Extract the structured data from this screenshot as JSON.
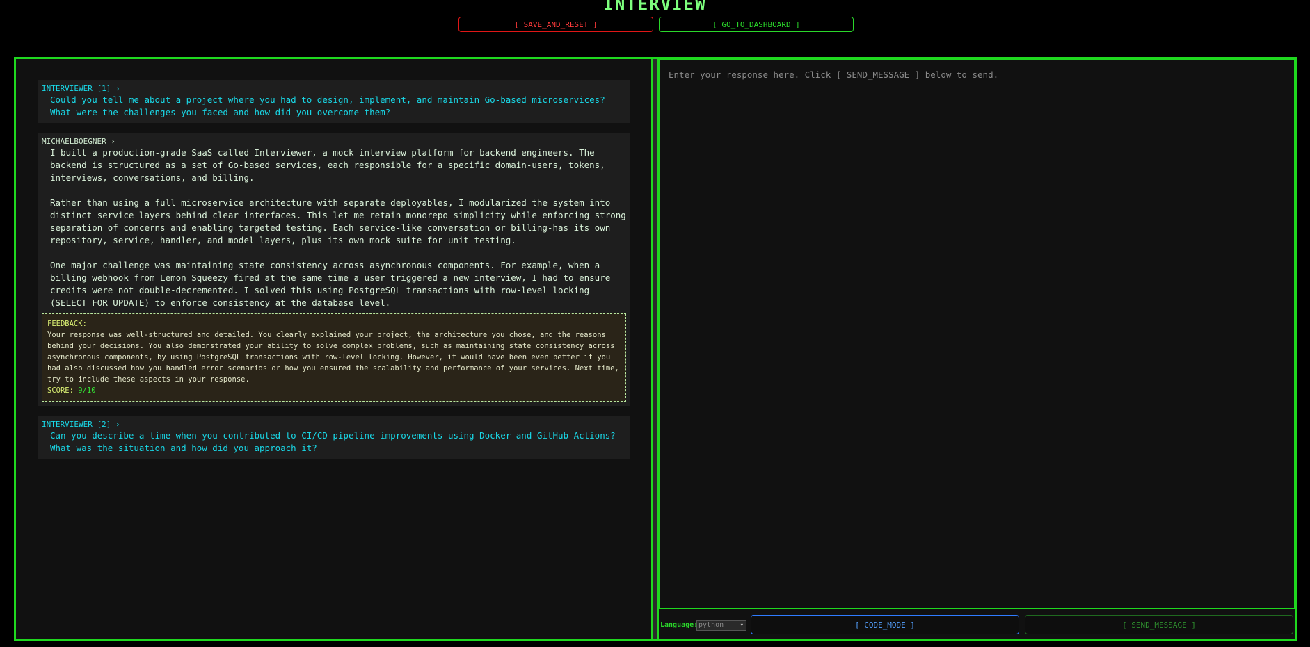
{
  "header": {
    "title": "INTERVIEW",
    "save_reset_label": "[ SAVE_AND_RESET ]",
    "dashboard_label": "[ GO_TO_DASHBOARD ]"
  },
  "chat": {
    "q1": {
      "label": "INTERVIEWER [1] ›",
      "text": "Could you tell me about a project where you had to design, implement, and maintain Go-based microservices? What were the challenges you faced and how did you overcome them?"
    },
    "a1": {
      "label": "MICHAELBOEGNER ›",
      "p1": "I built a production-grade SaaS called Interviewer, a mock interview platform for backend engineers. The backend is structured as a set of Go-based services, each responsible for a specific domain-users, tokens, interviews, conversations, and billing.",
      "p2": "Rather than using a full microservice architecture with separate deployables, I modularized the system into distinct service layers behind clear interfaces. This let me retain monorepo simplicity while enforcing strong separation of concerns and enabling targeted testing. Each service-like conversation or billing-has its own repository, service, handler, and model layers, plus its own mock suite for unit testing.",
      "p3": "One major challenge was maintaining state consistency across asynchronous components. For example, when a billing webhook from Lemon Squeezy fired at the same time a user triggered a new interview, I had to ensure credits were not double-decremented. I solved this using PostgreSQL transactions with row-level locking (SELECT FOR UPDATE) to enforce consistency at the database level.",
      "feedback": {
        "title": "FEEDBACK:",
        "text": "Your response was well-structured and detailed. You clearly explained your project, the architecture you chose, and the reasons behind your decisions. You also demonstrated your ability to solve complex problems, such as maintaining state consistency across asynchronous components, by using PostgreSQL transactions with row-level locking. However, it would have been even better if you had also discussed how you handled error scenarios or how you ensured the scalability and performance of your services. Next time, try to include these aspects in your response.",
        "score_label": "SCORE:",
        "score_value": "9/10"
      }
    },
    "q2": {
      "label": "INTERVIEWER [2] ›",
      "text": "Can you describe a time when you contributed to CI/CD pipeline improvements using Docker and GitHub Actions? What was the situation and how did you approach it?"
    }
  },
  "editor": {
    "placeholder": "Enter your response here. Click [ SEND_MESSAGE ] below to send."
  },
  "controls": {
    "language_label": "Language:",
    "language_value": "python",
    "code_mode_label": "[ CODE_MODE ]",
    "send_label": "[ SEND_MESSAGE ]"
  },
  "colors": {
    "accent_green": "#1fd81f",
    "question_cyan": "#19d7e6",
    "danger_red": "#ff3b3b",
    "code_blue": "#54a0ff"
  }
}
